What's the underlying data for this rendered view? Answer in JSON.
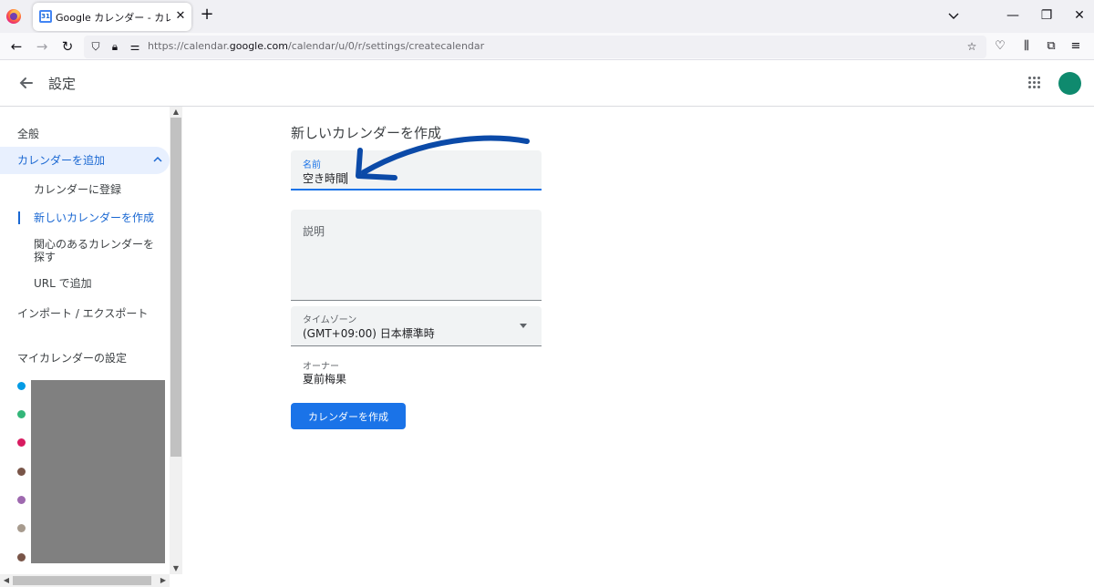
{
  "browser": {
    "tab_title": "Google カレンダー - カレンダーを作成",
    "tab_icon_text": "31",
    "url_prefix": "https://calendar.",
    "url_domain": "google.com",
    "url_path": "/calendar/u/0/r/settings/createcalendar"
  },
  "header": {
    "title": "設定"
  },
  "sidebar": {
    "general": "全般",
    "add_calendar": "カレンダーを追加",
    "sub_items": [
      "カレンダーに登録",
      "新しいカレンダーを作成",
      "関心のあるカレンダーを探す",
      "URL で追加"
    ],
    "import_export": "インポート / エクスポート",
    "my_calendars_heading": "マイカレンダーの設定",
    "calendar_colors": [
      "#039be5",
      "#33b679",
      "#d81b60",
      "#795548",
      "#9e69af",
      "#a79b8e",
      "#795548"
    ]
  },
  "form": {
    "title": "新しいカレンダーを作成",
    "name_label": "名前",
    "name_value": "空き時間",
    "description_label": "説明",
    "timezone_label": "タイムゾーン",
    "timezone_value": "(GMT+09:00) 日本標準時",
    "owner_label": "オーナー",
    "owner_value": "夏前梅果",
    "create_button": "カレンダーを作成"
  },
  "colors": {
    "accent": "#1a73e8",
    "annotation_arrow": "#0b4aa8",
    "avatar": "#0f8a6e"
  }
}
